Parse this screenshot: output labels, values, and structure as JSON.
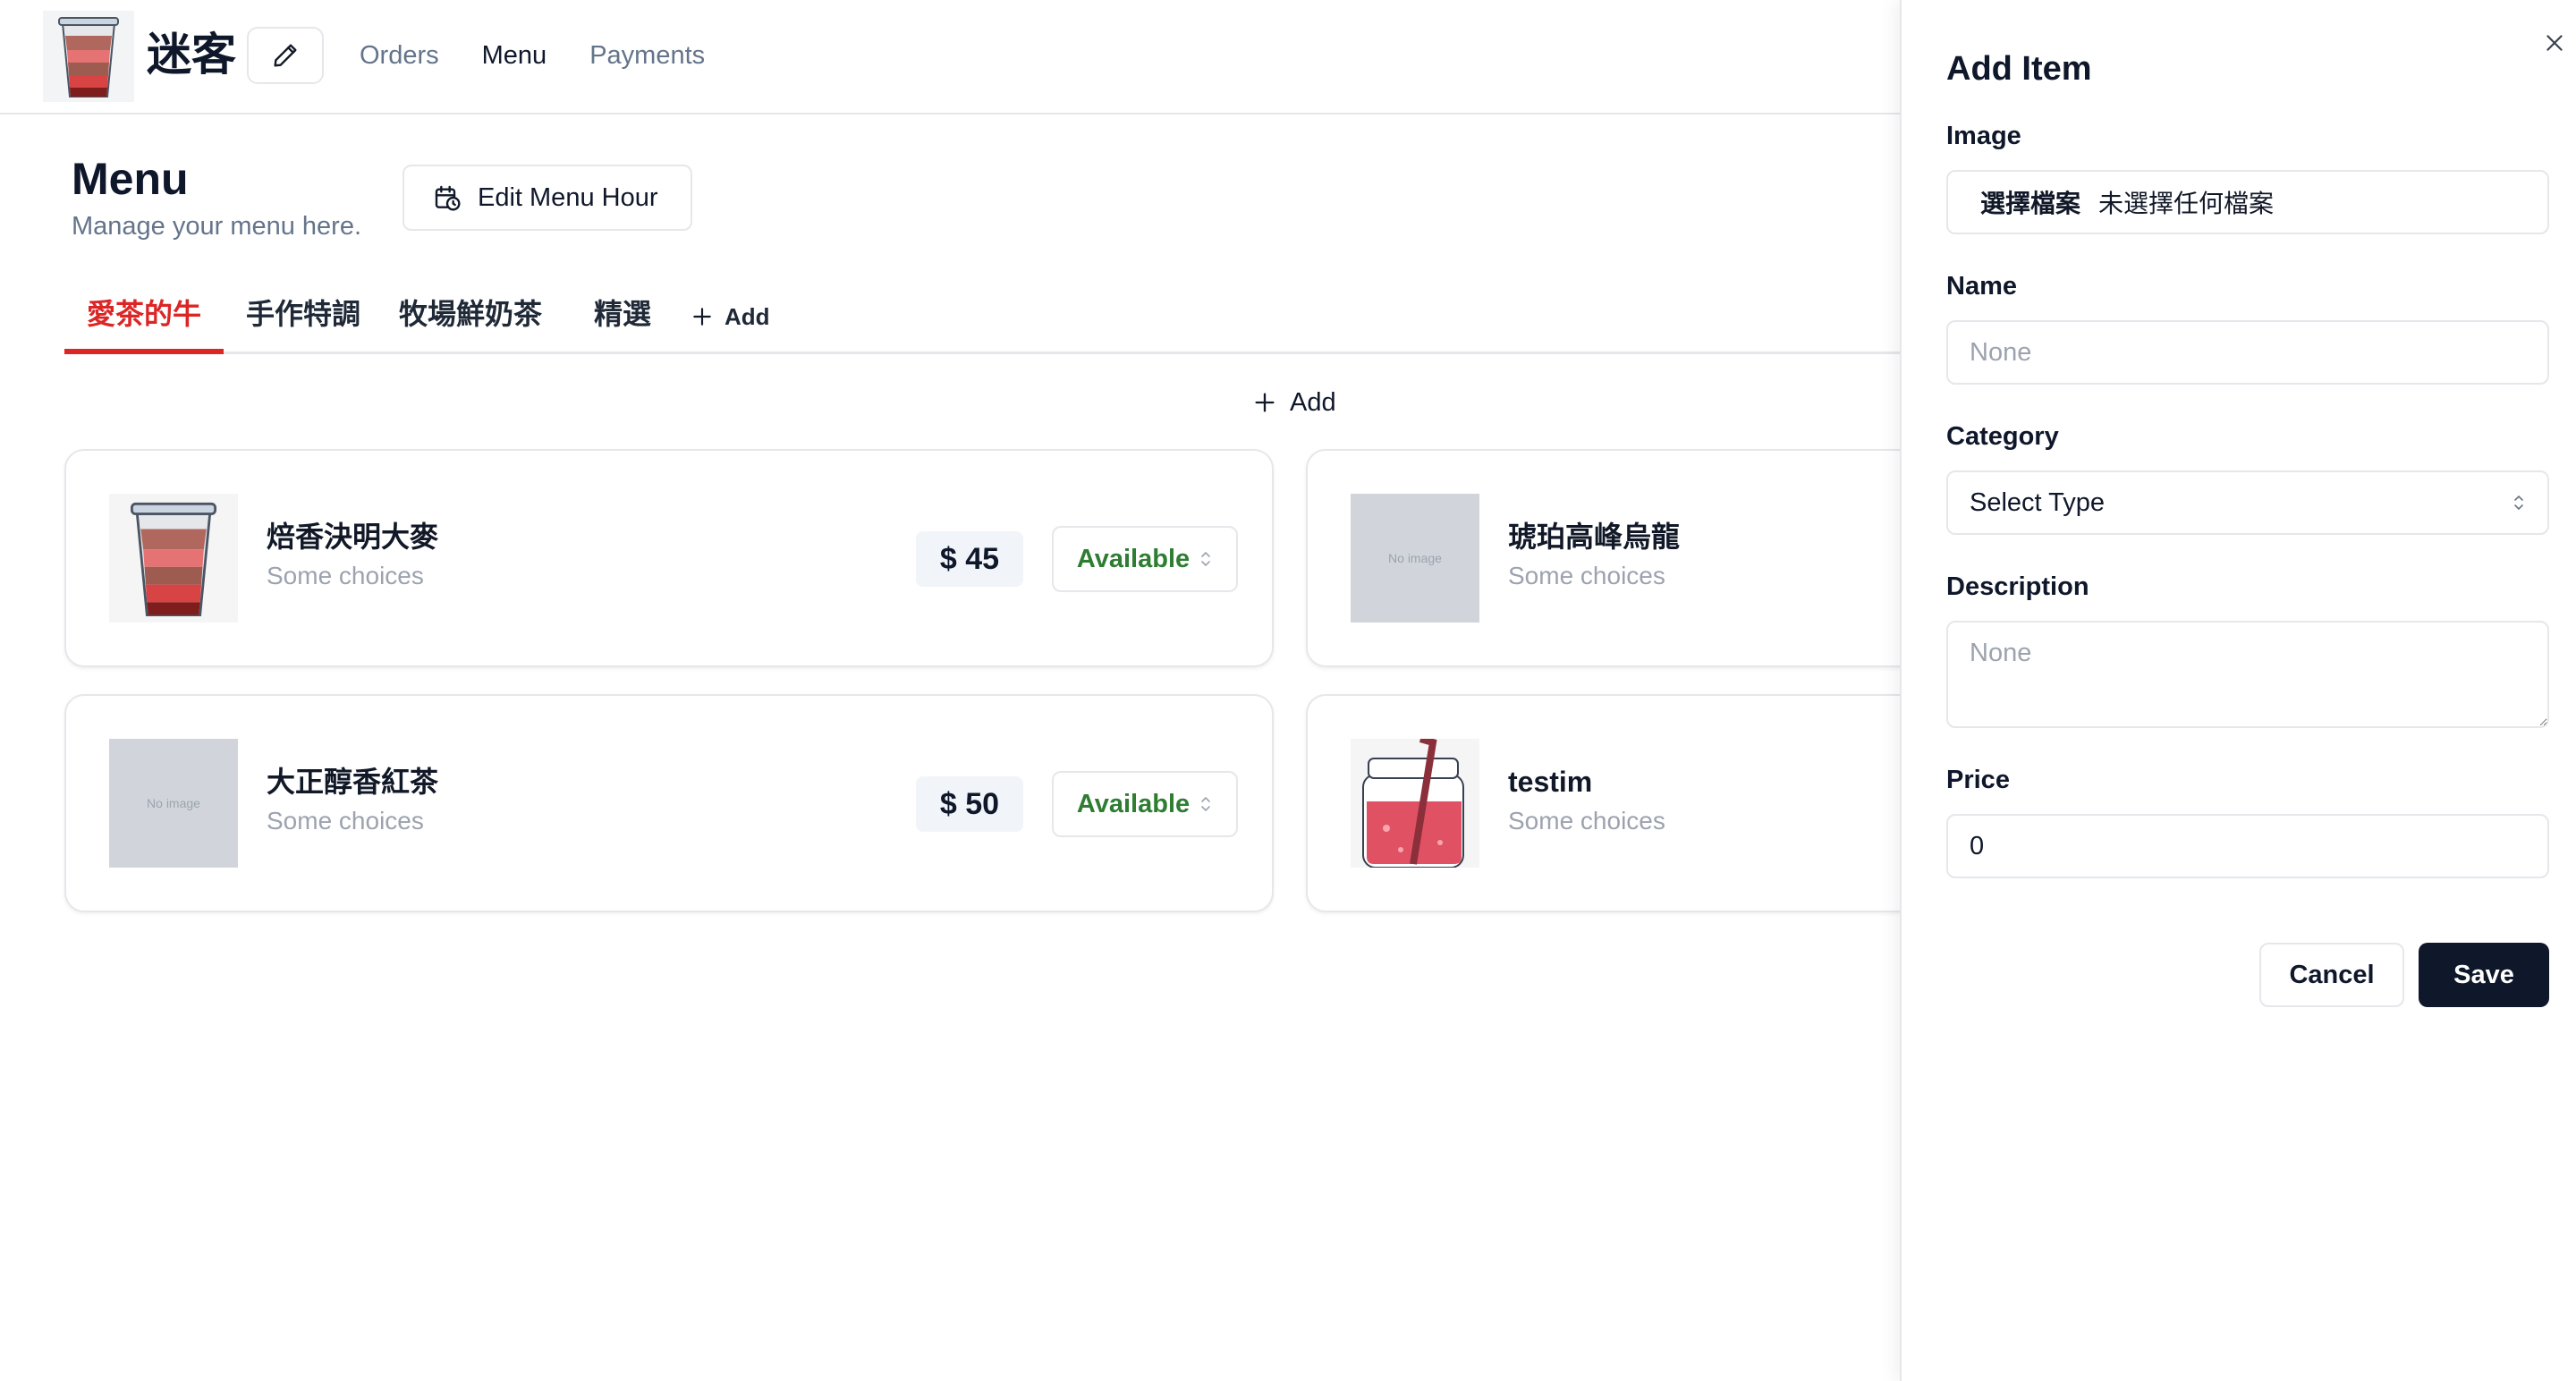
{
  "header": {
    "brand": "迷客",
    "logo_icon": "drink-cup-icon",
    "edit_icon": "pencil-icon",
    "nav": [
      {
        "label": "Orders",
        "active": false
      },
      {
        "label": "Menu",
        "active": true
      },
      {
        "label": "Payments",
        "active": false
      }
    ]
  },
  "page": {
    "title": "Menu",
    "subtitle": "Manage your menu here.",
    "edit_hour_label": "Edit Menu Hour",
    "edit_hour_icon": "calendar-clock-icon"
  },
  "tabs": {
    "items": [
      {
        "label": "愛茶的牛",
        "active": true
      },
      {
        "label": "手作特調",
        "active": false
      },
      {
        "label": "牧場鮮奶茶",
        "active": false
      },
      {
        "label": "精選",
        "active": false
      }
    ],
    "add_label": "Add"
  },
  "main": {
    "add_label": "Add"
  },
  "items": [
    {
      "name": "焙香決明大麥",
      "choices": "Some choices",
      "price": "$ 45",
      "status": "Available",
      "image": "drink-cup"
    },
    {
      "name": "琥珀高峰烏龍",
      "choices": "Some choices",
      "image": "no-image",
      "no_image_text": "No image"
    },
    {
      "name": "大正醇香紅茶",
      "choices": "Some choices",
      "price": "$ 50",
      "status": "Available",
      "image": "no-image",
      "no_image_text": "No image"
    },
    {
      "name": "testim",
      "choices": "Some choices",
      "image": "jar-drink"
    }
  ],
  "drawer": {
    "title": "Add Item",
    "image_label": "Image",
    "file_button": "選擇檔案",
    "file_name": "未選擇任何檔案",
    "name_label": "Name",
    "name_placeholder": "None",
    "category_label": "Category",
    "category_value": "Select Type",
    "description_label": "Description",
    "description_placeholder": "None",
    "price_label": "Price",
    "price_value": "0",
    "cancel_label": "Cancel",
    "save_label": "Save"
  },
  "colors": {
    "accent": "#dc2626",
    "available": "#2e7d32",
    "primary_button": "#0f172a"
  }
}
